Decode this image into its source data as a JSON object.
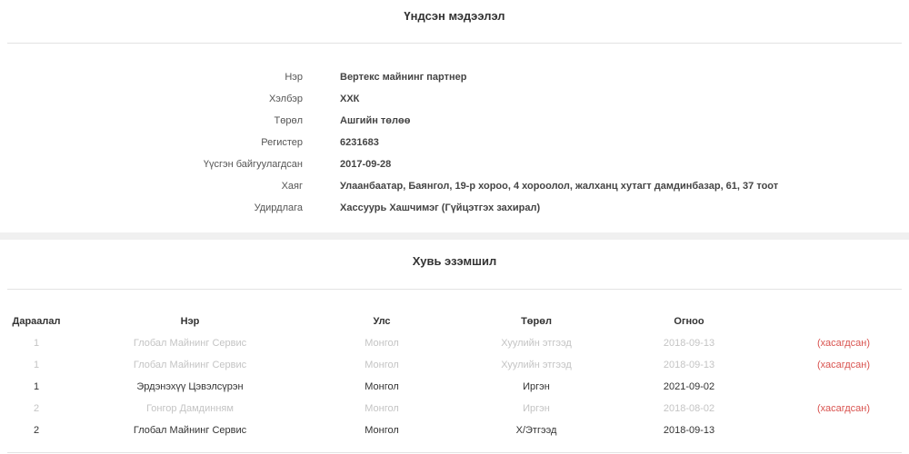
{
  "basic_info": {
    "title": "Үндсэн мэдээлэл",
    "fields": [
      {
        "label": "Нэр",
        "value": "Вертекс майнинг партнер"
      },
      {
        "label": "Хэлбэр",
        "value": "ХХК"
      },
      {
        "label": "Төрөл",
        "value": "Ашгийн төлөө"
      },
      {
        "label": "Регистер",
        "value": "6231683"
      },
      {
        "label": "Үүсгэн байгуулагдсан",
        "value": "2017-09-28"
      },
      {
        "label": "Хаяг",
        "value": "Улаанбаатар, Баянгол, 19-р хороо, 4 хороолол, жалханц хутагт дамдинбазар, 61, 37 тоот"
      },
      {
        "label": "Удирдлага",
        "value": "Хассуурь Хашчимэг (Гүйцэтгэх захирал)"
      }
    ]
  },
  "ownership": {
    "title": "Хувь эзэмшил",
    "columns": [
      "Дараалал",
      "Нэр",
      "Улс",
      "Төрөл",
      "Огноо"
    ],
    "rows": [
      {
        "order": "1",
        "name": "Глобал Майнинг Сервис",
        "country": "Монгол",
        "type": "Хуулийн этгээд",
        "date": "2018-09-13",
        "status": "(хасагдсан)"
      },
      {
        "order": "1",
        "name": "Глобал Майнинг Сервис",
        "country": "Монгол",
        "type": "Хуулийн этгээд",
        "date": "2018-09-13",
        "status": "(хасагдсан)"
      },
      {
        "order": "1",
        "name": "Эрдэнэхүү Цэвэлсүрэн",
        "country": "Монгол",
        "type": "Иргэн",
        "date": "2021-09-02",
        "status": ""
      },
      {
        "order": "2",
        "name": "Гонгор Дамдинням",
        "country": "Монгол",
        "type": "Иргэн",
        "date": "2018-08-02",
        "status": "(хасагдсан)"
      },
      {
        "order": "2",
        "name": "Глобал Майнинг Сервис",
        "country": "Монгол",
        "type": "Х/Этгээд",
        "date": "2018-09-13",
        "status": ""
      }
    ]
  }
}
